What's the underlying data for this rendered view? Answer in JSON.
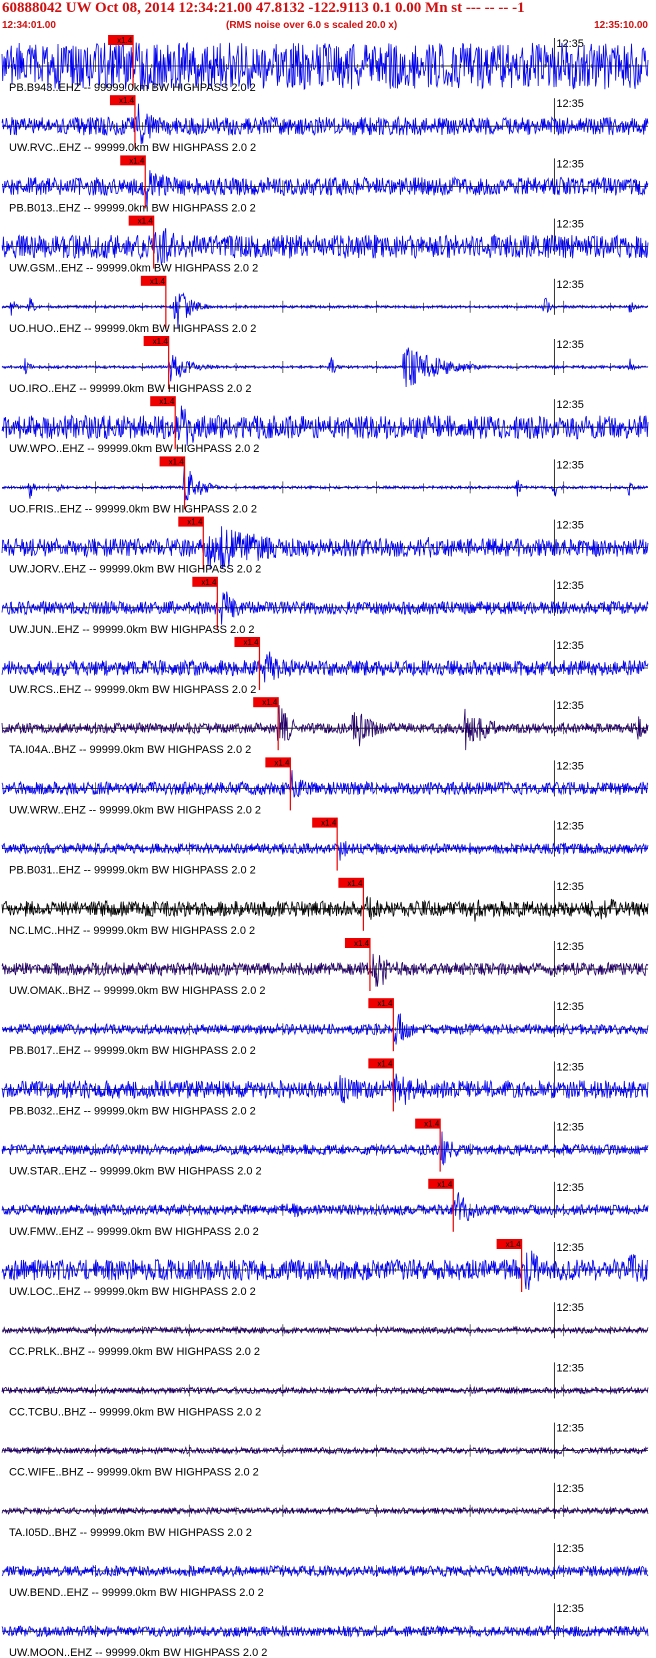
{
  "header": {
    "title": "60888042 UW Oct 08, 2014 12:34:21.00   47.8132 -122.9113  0.1 0.00 Mn st --- -- --  -1",
    "start_time": "12:34:01.00",
    "note": "(RMS noise over 6.0 s scaled 20.0 x)",
    "end_time": "12:35:10.00"
  },
  "chart_data": {
    "type": "line",
    "x_start_seconds": 0,
    "x_end_seconds": 69,
    "minute_mark_seconds": 59,
    "minute_mark_label": "12:35",
    "pick_label": "x1.4",
    "trace_color_default": "#0000ee",
    "pick_color": "#ee0000",
    "series": [
      {
        "name": "PB.B943..EHZ -- 99999.0km BW  HIGHPASS  2.0  2",
        "p_pick_s": 14.0,
        "color": "#0000ee",
        "amp": 0.9,
        "bursts": [
          [
            14.5,
            1.0,
            2.5
          ]
        ]
      },
      {
        "name": "UW.RVC..EHZ -- 99999.0km BW  HIGHPASS  2.0  2",
        "p_pick_s": 14.2,
        "color": "#0000ee",
        "amp": 0.35,
        "bursts": [
          [
            14.5,
            0.9,
            2.0
          ]
        ]
      },
      {
        "name": "PB.B013..EHZ -- 99999.0km BW  HIGHPASS  2.0  2",
        "p_pick_s": 15.3,
        "color": "#0000ee",
        "amp": 0.35,
        "bursts": [
          [
            15.5,
            0.9,
            2.5
          ]
        ]
      },
      {
        "name": "UW.GSM..EHZ -- 99999.0km BW  HIGHPASS  2.0  2",
        "p_pick_s": 16.2,
        "color": "#0000ee",
        "amp": 0.45,
        "bursts": [
          [
            16.5,
            1.0,
            3.0
          ],
          [
            52,
            0.5,
            1.5
          ],
          [
            61,
            0.5,
            1.2
          ]
        ]
      },
      {
        "name": "UO.HUO..EHZ -- 99999.0km BW  HIGHPASS  2.0  2",
        "p_pick_s": 17.5,
        "color": "#0000ee",
        "amp": 0.05,
        "bursts": [
          [
            18.5,
            1.0,
            1.5
          ],
          [
            1,
            0.5,
            0.4
          ],
          [
            3,
            0.5,
            0.4
          ],
          [
            58,
            0.5,
            0.4
          ],
          [
            67,
            0.5,
            0.4
          ]
        ]
      },
      {
        "name": "UO.IRO..EHZ -- 99999.0km BW  HIGHPASS  2.0  2",
        "p_pick_s": 17.8,
        "color": "#0000ee",
        "amp": 0.05,
        "bursts": [
          [
            18,
            0.7,
            2.0
          ],
          [
            2.5,
            0.5,
            0.4
          ],
          [
            35,
            0.6,
            0.5
          ],
          [
            43,
            1.0,
            3.5
          ],
          [
            67,
            0.4,
            0.4
          ]
        ]
      },
      {
        "name": "UW.WPO..EHZ -- 99999.0km BW  HIGHPASS  2.0  2",
        "p_pick_s": 18.5,
        "color": "#0000ee",
        "amp": 0.45,
        "bursts": [
          [
            19,
            1.0,
            3.0
          ],
          [
            25,
            0.7,
            1.5
          ]
        ]
      },
      {
        "name": "UO.FRIS..EHZ -- 99999.0km BW  HIGHPASS  2.0  2",
        "p_pick_s": 19.5,
        "color": "#0000ee",
        "amp": 0.05,
        "bursts": [
          [
            19.5,
            1.0,
            1.5
          ],
          [
            3,
            0.5,
            0.4
          ],
          [
            6,
            0.4,
            0.3
          ],
          [
            55,
            0.4,
            0.4
          ],
          [
            59,
            0.5,
            0.5
          ],
          [
            67,
            0.4,
            0.4
          ]
        ]
      },
      {
        "name": "UW.JORV..EHZ -- 99999.0km BW  HIGHPASS  2.0  2",
        "p_pick_s": 21.5,
        "color": "#0000ee",
        "amp": 0.35,
        "bursts": [
          [
            22,
            1.0,
            8.0
          ],
          [
            45,
            0.5,
            3.0
          ]
        ]
      },
      {
        "name": "UW.JUN..EHZ -- 99999.0km BW  HIGHPASS  2.0  2",
        "p_pick_s": 23.0,
        "color": "#0000ee",
        "amp": 0.25,
        "bursts": [
          [
            23.5,
            0.8,
            2.0
          ]
        ]
      },
      {
        "name": "UW.RCS..EHZ -- 99999.0km BW  HIGHPASS  2.0  2",
        "p_pick_s": 27.5,
        "color": "#0000ee",
        "amp": 0.3,
        "bursts": [
          [
            27.8,
            1.0,
            2.0
          ],
          [
            50,
            0.4,
            2.0
          ]
        ]
      },
      {
        "name": "TA.I04A..BHZ -- 99999.0km BW  HIGHPASS  2.0  2",
        "p_pick_s": 29.5,
        "color": "#220066",
        "amp": 0.2,
        "bursts": [
          [
            29.5,
            1.0,
            1.5
          ],
          [
            37.5,
            1.0,
            2.0
          ],
          [
            49.5,
            1.0,
            2.5
          ],
          [
            68,
            0.6,
            0.8
          ]
        ]
      },
      {
        "name": "UW.WRW..EHZ -- 99999.0km BW  HIGHPASS  2.0  2",
        "p_pick_s": 30.8,
        "color": "#0000ee",
        "amp": 0.25,
        "bursts": [
          [
            31,
            0.8,
            1.5
          ]
        ]
      },
      {
        "name": "PB.B031..EHZ -- 99999.0km BW  HIGHPASS  2.0  2",
        "p_pick_s": 35.8,
        "color": "#0000ee",
        "amp": 0.2,
        "bursts": [
          [
            36,
            0.5,
            2.0
          ]
        ]
      },
      {
        "name": "NC.LMC..HHZ -- 99999.0km BW  HIGHPASS  2.0  2",
        "p_pick_s": 38.6,
        "color": "#000000",
        "amp": 0.3,
        "bursts": [
          [
            39,
            0.5,
            3.0
          ],
          [
            50.5,
            0.5,
            2.0
          ],
          [
            64,
            0.6,
            2.5
          ]
        ]
      },
      {
        "name": "UW.OMAK..BHZ -- 99999.0km BW  HIGHPASS  2.0  2",
        "p_pick_s": 39.3,
        "color": "#220066",
        "amp": 0.25,
        "bursts": [
          [
            39.5,
            1.0,
            2.5
          ]
        ]
      },
      {
        "name": "PB.B017..EHZ -- 99999.0km BW  HIGHPASS  2.0  2",
        "p_pick_s": 41.8,
        "color": "#0000ee",
        "amp": 0.2,
        "bursts": [
          [
            42,
            0.8,
            2.0
          ]
        ]
      },
      {
        "name": "PB.B032..EHZ -- 99999.0km BW  HIGHPASS  2.0  2",
        "p_pick_s": 41.8,
        "color": "#0000ee",
        "amp": 0.35,
        "bursts": [
          [
            42,
            1.0,
            3.0
          ],
          [
            36,
            0.6,
            5.0
          ]
        ]
      },
      {
        "name": "UW.STAR..EHZ -- 99999.0km BW  HIGHPASS  2.0  2",
        "p_pick_s": 46.8,
        "color": "#0000ee",
        "amp": 0.2,
        "bursts": [
          [
            47,
            0.8,
            1.5
          ],
          [
            55,
            0.4,
            0.8
          ]
        ]
      },
      {
        "name": "UW.FMW..EHZ -- 99999.0km BW  HIGHPASS  2.0  2",
        "p_pick_s": 48.2,
        "color": "#0000ee",
        "amp": 0.2,
        "bursts": [
          [
            48.5,
            0.8,
            2.0
          ],
          [
            30.5,
            0.5,
            2.0
          ]
        ]
      },
      {
        "name": "UW.LOC..EHZ -- 99999.0km BW  HIGHPASS  2.0  2",
        "p_pick_s": 55.5,
        "color": "#0000ee",
        "amp": 0.4,
        "bursts": [
          [
            56,
            1.0,
            2.0
          ],
          [
            67,
            0.8,
            2.5
          ]
        ]
      },
      {
        "name": "CC.PRLK..BHZ -- 99999.0km BW  HIGHPASS  2.0  2",
        "p_pick_s": null,
        "color": "#220066",
        "amp": 0.12,
        "bursts": []
      },
      {
        "name": "CC.TCBU..BHZ -- 99999.0km BW  HIGHPASS  2.0  2",
        "p_pick_s": null,
        "color": "#220066",
        "amp": 0.12,
        "bursts": []
      },
      {
        "name": "CC.WIFE..BHZ -- 99999.0km BW  HIGHPASS  2.0  2",
        "p_pick_s": null,
        "color": "#220066",
        "amp": 0.12,
        "bursts": []
      },
      {
        "name": "TA.I05D..BHZ -- 99999.0km BW  HIGHPASS  2.0  2",
        "p_pick_s": null,
        "color": "#220066",
        "amp": 0.12,
        "bursts": []
      },
      {
        "name": "UW.BEND..EHZ -- 99999.0km BW  HIGHPASS  2.0  2",
        "p_pick_s": null,
        "color": "#0000ee",
        "amp": 0.2,
        "bursts": []
      },
      {
        "name": "UW.MOON..EHZ -- 99999.0km BW  HIGHPASS  2.0  2",
        "p_pick_s": null,
        "color": "#0000ee",
        "amp": 0.2,
        "bursts": []
      }
    ]
  }
}
